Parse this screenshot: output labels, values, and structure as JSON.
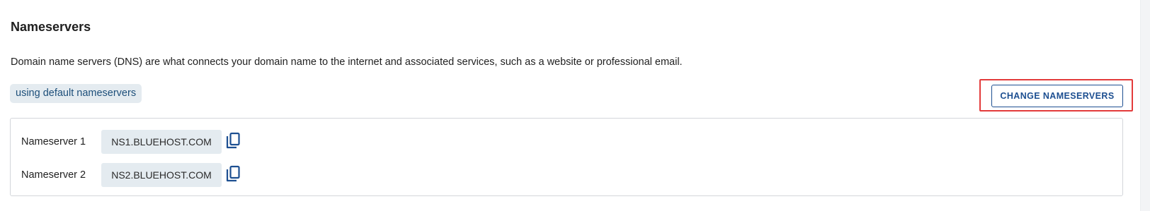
{
  "section": {
    "title": "Nameservers",
    "description": "Domain name servers (DNS) are what connects your domain name to the internet and associated services, such as a website or professional email.",
    "status_badge": "using default nameservers",
    "change_button_label": "CHANGE NAMESERVERS"
  },
  "nameservers": [
    {
      "label": "Nameserver 1",
      "value": "NS1.BLUEHOST.COM",
      "icon": "copy-icon"
    },
    {
      "label": "Nameserver 2",
      "value": "NS2.BLUEHOST.COM",
      "icon": "copy-icon"
    }
  ],
  "colors": {
    "accent": "#1d4f91",
    "badge_bg": "#e4ebf0",
    "highlight": "#e33b3b"
  }
}
